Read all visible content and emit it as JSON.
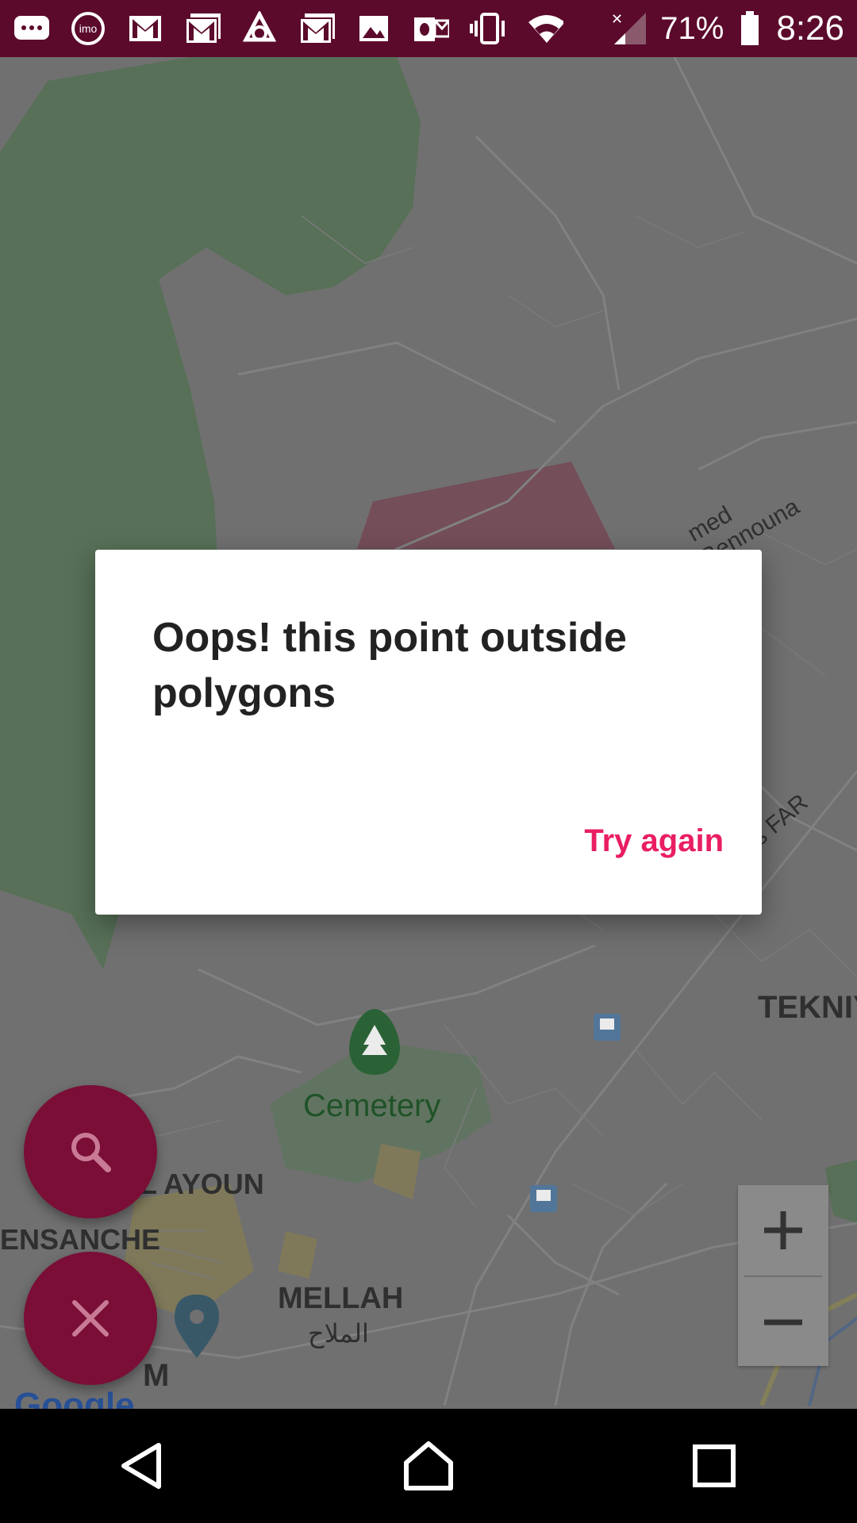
{
  "status_bar": {
    "battery": "71%",
    "time": "8:26",
    "icons": [
      "chat-icon",
      "imo-icon",
      "gmail-icon",
      "gmail-icon",
      "app-icon",
      "gmail-icon",
      "image-icon",
      "outlook-icon",
      "vibrate-icon",
      "wifi-icon",
      "signal-icon",
      "battery-icon"
    ]
  },
  "map": {
    "labels": {
      "cemetery": "Cemetery",
      "el_ayoun": "L AYOUN",
      "ensanche": "ENSANCHE",
      "mellah": "MELLAH",
      "mellah_ar": "الملاح",
      "tekni": "TEKNIY",
      "bennouna": "med Bennouna",
      "des_far": "e des FAR",
      "m": "M"
    },
    "google_logo": "Google",
    "colors": {
      "park": "#5f7a5f",
      "pink_zone": "#7e5561",
      "yellow_zone": "#8a8462"
    }
  },
  "dialog": {
    "title": "Oops! this point outside polygons",
    "action": "Try again"
  },
  "fabs": {
    "search_icon": "search-icon",
    "close_icon": "close-icon",
    "color": "#7a0e37"
  },
  "zoom": {
    "in": "+",
    "out": "−"
  },
  "nav_bar": {
    "icons": [
      "back-icon",
      "home-icon",
      "recents-icon"
    ]
  }
}
